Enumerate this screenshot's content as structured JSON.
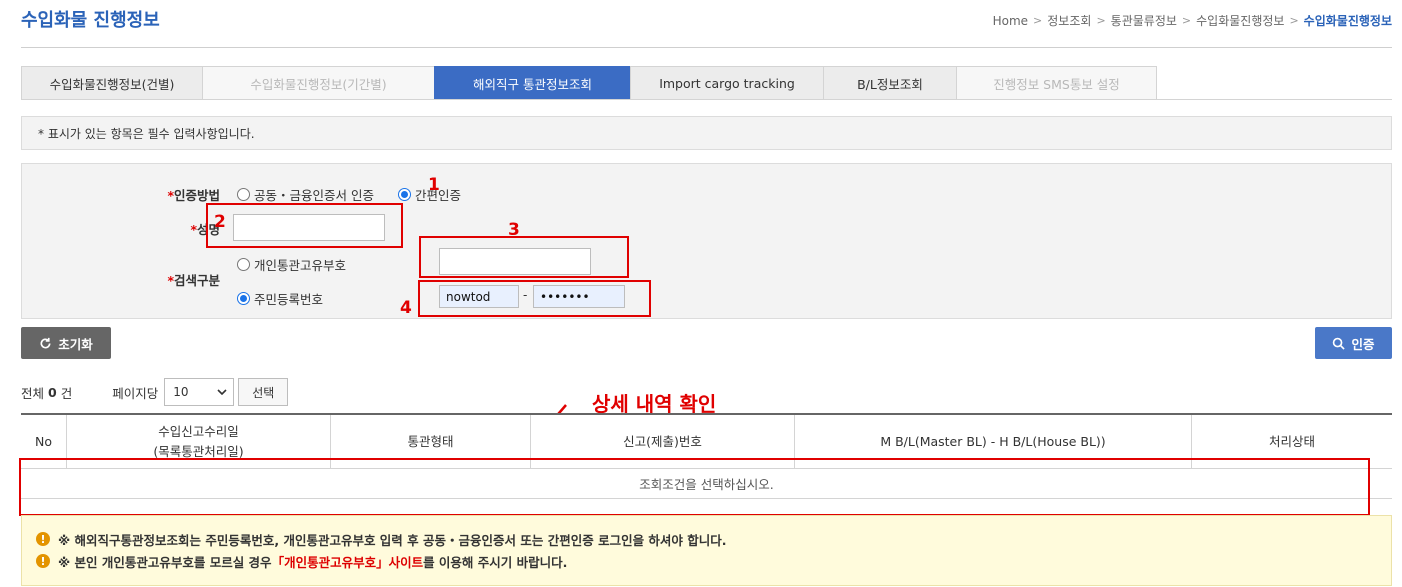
{
  "page_title": "수입화물 진행정보",
  "breadcrumb": [
    "Home",
    "정보조회",
    "통관물류정보",
    "수입화물진행정보",
    "수입화물진행정보"
  ],
  "tabs": [
    {
      "label": "수입화물진행정보(건별)",
      "state": "normal"
    },
    {
      "label": "수입화물진행정보(기간별)",
      "state": "disabled"
    },
    {
      "label": "해외직구 통관정보조회",
      "state": "active"
    },
    {
      "label": "Import cargo tracking",
      "state": "normal"
    },
    {
      "label": "B/L정보조회",
      "state": "normal"
    },
    {
      "label": "진행정보 SMS통보 설정",
      "state": "disabled"
    }
  ],
  "notice": "* 표시가 있는 항목은 필수 입력사항입니다.",
  "form": {
    "auth_label": "인증방법",
    "auth_options": [
      {
        "label": "공동・금융인증서 인증",
        "checked": false
      },
      {
        "label": "간편인증",
        "checked": true
      }
    ],
    "name_label": "성명",
    "name_value": "",
    "search_label": "검색구분",
    "search_options": [
      {
        "label": "개인통관고유부호",
        "checked": false
      },
      {
        "label": "주민등록번호",
        "checked": true
      }
    ],
    "customs_code_value": "",
    "rrn_front_value": "nowtod",
    "rrn_separator": "-",
    "rrn_back_value": "•••••••"
  },
  "annotations": {
    "n1": "1",
    "n2": "2",
    "n3": "3",
    "n4": "4",
    "detail": "상세 내역 확인",
    "color": "#e00000"
  },
  "buttons": {
    "reset": "초기화",
    "auth": "인증",
    "select": "선택"
  },
  "summary": {
    "total_prefix": "전체",
    "total_count": "0",
    "total_suffix": "건",
    "per_page_label": "페이지당",
    "per_page_value": "10"
  },
  "grid": {
    "headers": [
      "No",
      "수입신고수리일\n(목록통관처리일)",
      "통관형태",
      "신고(제출)번호",
      "M B/L(Master BL) - H B/L(House BL))",
      "처리상태"
    ],
    "empty_message": "조회조건을 선택하십시오."
  },
  "warnings": {
    "line1": "※ 해외직구통관정보조회는 주민등록번호, 개인통관고유부호 입력 후 공동・금융인증서 또는 간편인증 로그인을 하셔야 합니다.",
    "line2_before": "※ 본인 개인통관고유부호를 모르실 경우 ",
    "line2_link": "「개인통관고유부호」사이트",
    "line2_after": "를 이용해 주시기 바랍니다."
  },
  "colors": {
    "primary": "#2b63b8",
    "active_tab": "#3b6cc4",
    "auth_button": "#4a78c8",
    "reset_button": "#666666",
    "warning_bg": "#fffbdc"
  }
}
